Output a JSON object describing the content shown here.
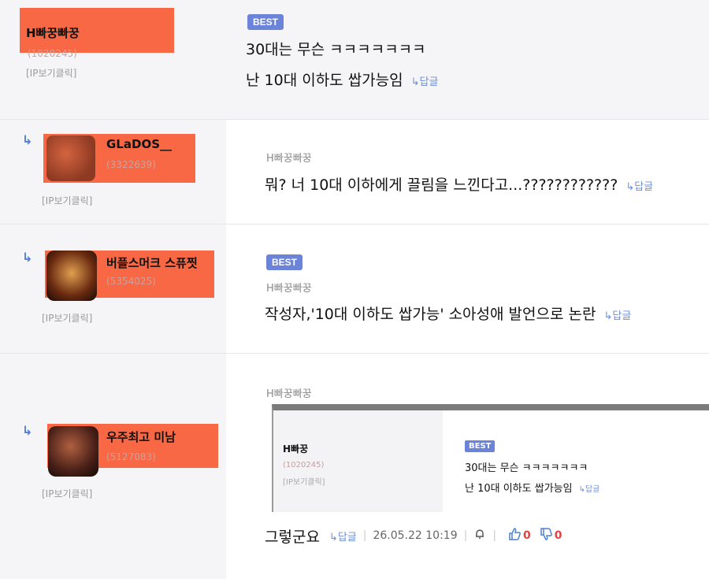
{
  "comments": [
    {
      "nickname": "H빠꿍빠꿍",
      "user_id": "(1020245)",
      "ip_label": "[IP보기클릭]",
      "badge": "BEST",
      "line1": "30대는 무슨 ㅋㅋㅋㅋㅋㅋㅋ",
      "line2": "난 10대 이하도 쌉가능임",
      "reply_label": "↳답글"
    },
    {
      "nickname": "GLaDOS__",
      "user_id": "(3322639)",
      "ip_label": "[IP보기클릭]",
      "target_author": "H빠꿍빠꿍",
      "text": "뭐? 너 10대 이하에게 끌림을 느낀다고...????????????",
      "reply_label": "↳답글"
    },
    {
      "nickname": "버플스머크 스퓨찟",
      "user_id": "(5354025)",
      "ip_label": "[IP보기클릭]",
      "badge": "BEST",
      "target_author": "H빠꿍빠꿍",
      "text": "작성자,'10대 이하도 쌉가능' 소아성애 발언으로 논란",
      "reply_label": "↳답글"
    },
    {
      "nickname": "우주최고 미남",
      "user_id": "(5127083)",
      "ip_label": "[IP보기클릭]",
      "target_author": "H빠꿍빠꿍",
      "embed": {
        "nickname": "H빠꿍",
        "user_id": "(1020245)",
        "ip_label": "[IP보기클릭]",
        "badge": "BEST",
        "line1": "30대는 무슨 ㅋㅋㅋㅋㅋㅋㅋ",
        "line2": "난 10대 이하도 쌉가능임",
        "reply_label": "↳답글"
      },
      "text": "그렇군요",
      "reply_label": "↳답글",
      "date": "26.05.22 10:19",
      "likes": "0",
      "dislikes": "0"
    }
  ],
  "icons": {
    "reply_arrow": "reply-arrow-icon",
    "report": "bell-icon",
    "like": "thumbs-up-icon",
    "dislike": "thumbs-down-icon"
  },
  "colors": {
    "redaction": "#f8603a",
    "badge": "#6b83d8",
    "link": "#6f8fd6"
  }
}
